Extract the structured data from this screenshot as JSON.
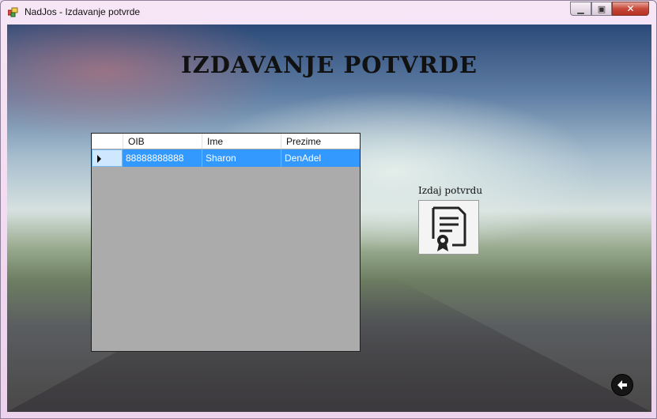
{
  "window": {
    "title": "NadJos - Izdavanje potvrde"
  },
  "heading": "IZDAVANJE POTVRDE",
  "grid": {
    "columns": [
      "OIB",
      "Ime",
      "Prezime"
    ],
    "rows": [
      {
        "oib": "88888888888",
        "ime": "Sharon",
        "prezime": "DenAdel",
        "selected": true
      }
    ]
  },
  "issue": {
    "label": "Izdaj potvrdu",
    "icon": "certificate-icon"
  },
  "back": {
    "icon": "back-arrow-icon"
  },
  "colors": {
    "selection": "#3399ff",
    "grid_background": "#ababab"
  }
}
